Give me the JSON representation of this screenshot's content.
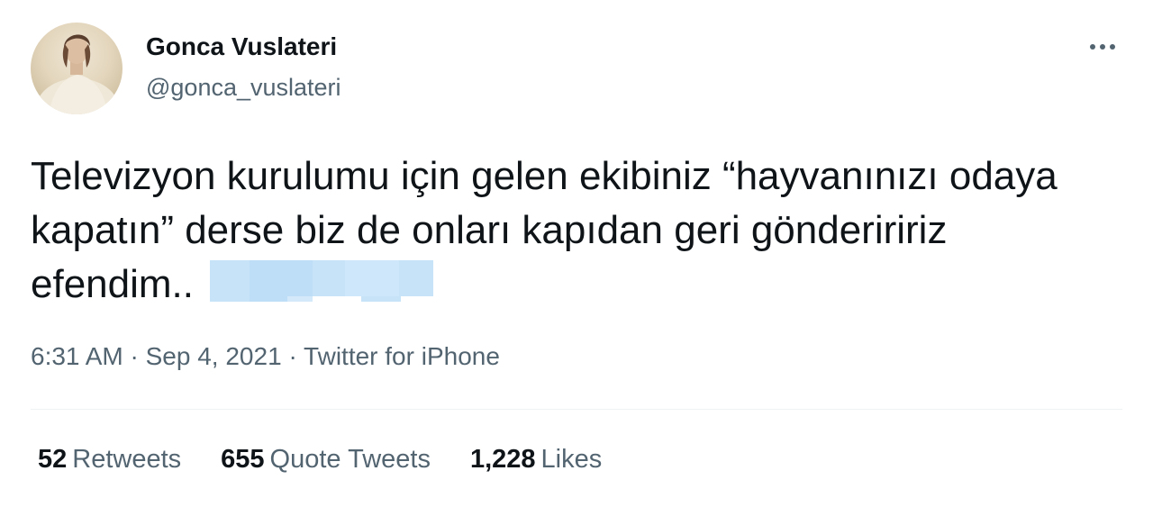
{
  "tweet": {
    "author": {
      "display_name": "Gonca Vuslateri",
      "handle": "@gonca_vuslateri"
    },
    "more_icon": "more-horizontal-icon",
    "text": "Televizyon kurulumu için gelen ekibiniz “hayvanınızı odaya kapatın” derse biz de onları kapıdan geri gönderiririz efendim..",
    "emoji_placeholder": "blurred-emoji",
    "meta": {
      "time": "6:31 AM",
      "separator": "·",
      "date": "Sep 4, 2021",
      "source": "Twitter for iPhone"
    },
    "stats": {
      "retweets": {
        "count": "52",
        "label": "Retweets"
      },
      "quote_tweets": {
        "count": "655",
        "label": "Quote Tweets"
      },
      "likes": {
        "count": "1,228",
        "label": "Likes"
      }
    }
  },
  "colors": {
    "primary_text": "#0f1419",
    "secondary_text": "#536471",
    "divider": "#eff3f4",
    "emoji_blur": "#c6e3f8"
  }
}
